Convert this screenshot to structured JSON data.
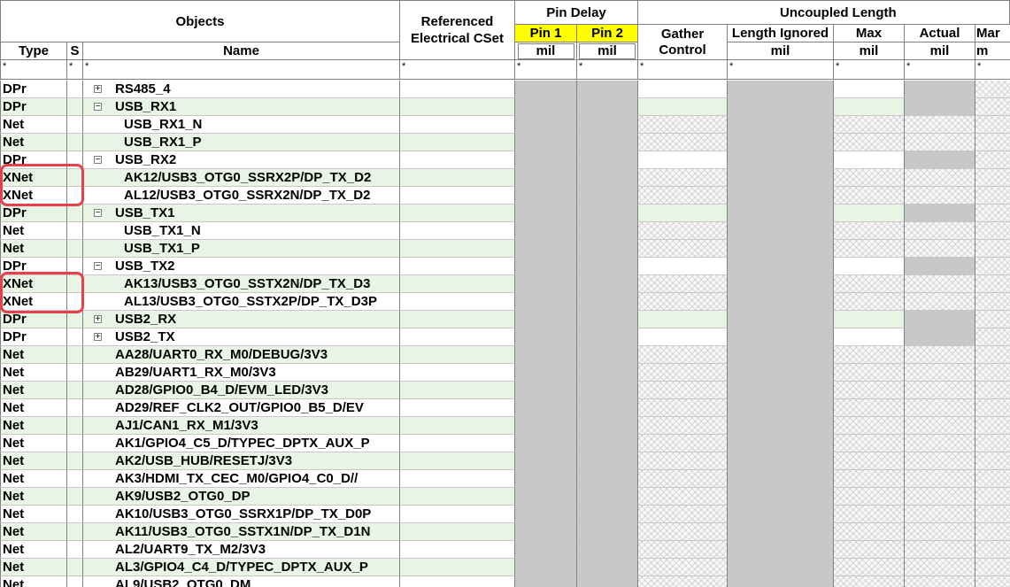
{
  "headers": {
    "objects": "Objects",
    "type": "Type",
    "s": "S",
    "name": "Name",
    "ref_cset": "Referenced Electrical CSet",
    "pin_delay": "Pin Delay",
    "pin1": "Pin 1",
    "pin2": "Pin 2",
    "pin_unit": "mil",
    "uncoupled_length": "Uncoupled Length",
    "gather_control": "Gather Control",
    "length_ignored": "Length Ignored",
    "length_ignored_unit": "mil",
    "max": "Max",
    "max_unit": "mil",
    "actual": "Actual",
    "actual_unit": "mil",
    "margin_partial": "Mar",
    "margin_unit_partial": "m"
  },
  "filter_symbol": "*",
  "toggle_symbols": {
    "expanded": "−",
    "collapsed": "+"
  },
  "rows": [
    {
      "type": "DPr",
      "name": "RS485_4",
      "level": 0,
      "toggle": "collapsed"
    },
    {
      "type": "DPr",
      "name": "USB_RX1",
      "level": 0,
      "toggle": "expanded"
    },
    {
      "type": "Net",
      "name": "USB_RX1_N",
      "level": 1,
      "toggle": "none"
    },
    {
      "type": "Net",
      "name": "USB_RX1_P",
      "level": 1,
      "toggle": "none"
    },
    {
      "type": "DPr",
      "name": "USB_RX2",
      "level": 0,
      "toggle": "expanded"
    },
    {
      "type": "XNet",
      "name": "AK12/USB3_OTG0_SSRX2P/DP_TX_D2",
      "level": 1,
      "toggle": "none"
    },
    {
      "type": "XNet",
      "name": "AL12/USB3_OTG0_SSRX2N/DP_TX_D2",
      "level": 1,
      "toggle": "none"
    },
    {
      "type": "DPr",
      "name": "USB_TX1",
      "level": 0,
      "toggle": "expanded"
    },
    {
      "type": "Net",
      "name": "USB_TX1_N",
      "level": 1,
      "toggle": "none"
    },
    {
      "type": "Net",
      "name": "USB_TX1_P",
      "level": 1,
      "toggle": "none"
    },
    {
      "type": "DPr",
      "name": "USB_TX2",
      "level": 0,
      "toggle": "expanded"
    },
    {
      "type": "XNet",
      "name": "AK13/USB3_OTG0_SSTX2N/DP_TX_D3",
      "level": 1,
      "toggle": "none"
    },
    {
      "type": "XNet",
      "name": "AL13/USB3_OTG0_SSTX2P/DP_TX_D3P",
      "level": 1,
      "toggle": "none"
    },
    {
      "type": "DPr",
      "name": "USB2_RX",
      "level": 0,
      "toggle": "collapsed"
    },
    {
      "type": "DPr",
      "name": "USB2_TX",
      "level": 0,
      "toggle": "collapsed"
    },
    {
      "type": "Net",
      "name": "AA28/UART0_RX_M0/DEBUG/3V3",
      "level": 0,
      "toggle": "none"
    },
    {
      "type": "Net",
      "name": "AB29/UART1_RX_M0/3V3",
      "level": 0,
      "toggle": "none"
    },
    {
      "type": "Net",
      "name": "AD28/GPIO0_B4_D/EVM_LED/3V3",
      "level": 0,
      "toggle": "none"
    },
    {
      "type": "Net",
      "name": "AD29/REF_CLK2_OUT/GPIO0_B5_D/EV",
      "level": 0,
      "toggle": "none"
    },
    {
      "type": "Net",
      "name": "AJ1/CAN1_RX_M1/3V3",
      "level": 0,
      "toggle": "none"
    },
    {
      "type": "Net",
      "name": "AK1/GPIO4_C5_D/TYPEC_DPTX_AUX_P",
      "level": 0,
      "toggle": "none"
    },
    {
      "type": "Net",
      "name": "AK2/USB_HUB/RESETJ/3V3",
      "level": 0,
      "toggle": "none"
    },
    {
      "type": "Net",
      "name": "AK3/HDMI_TX_CEC_M0/GPIO4_C0_D//",
      "level": 0,
      "toggle": "none"
    },
    {
      "type": "Net",
      "name": "AK9/USB2_OTG0_DP",
      "level": 0,
      "toggle": "none"
    },
    {
      "type": "Net",
      "name": "AK10/USB3_OTG0_SSRX1P/DP_TX_D0P",
      "level": 0,
      "toggle": "none"
    },
    {
      "type": "Net",
      "name": "AK11/USB3_OTG0_SSTX1N/DP_TX_D1N",
      "level": 0,
      "toggle": "none"
    },
    {
      "type": "Net",
      "name": "AL2/UART9_TX_M2/3V3",
      "level": 0,
      "toggle": "none"
    },
    {
      "type": "Net",
      "name": "AL3/GPIO4_C4_D/TYPEC_DPTX_AUX_P",
      "level": 0,
      "toggle": "none"
    },
    {
      "type": "Net",
      "name": "AL9/USB2_OTG0_DM",
      "level": 0,
      "toggle": "none"
    }
  ],
  "colors": {
    "row_green": "#e8f4e4",
    "pin_gray": "#c8c8c8",
    "pin_header_yellow": "#ffff00",
    "highlight_red": "#e8404a"
  }
}
